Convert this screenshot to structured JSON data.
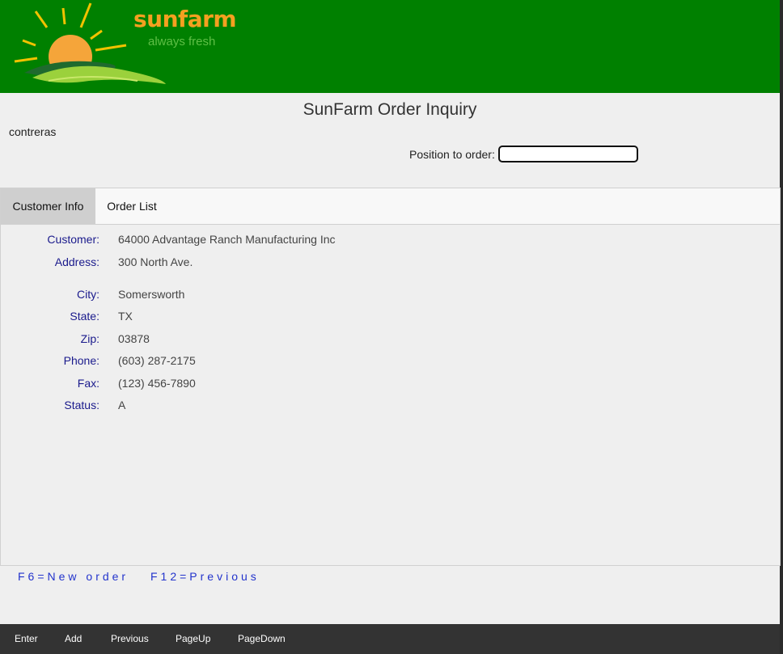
{
  "header": {
    "brand": "sunfarm",
    "tagline": "always fresh",
    "colors": {
      "background": "#008000",
      "brand": "#f5a020",
      "tagline": "#5fbf46"
    }
  },
  "page": {
    "title": "SunFarm Order Inquiry",
    "user": "contreras",
    "position_label": "Position to order:",
    "position_value": ""
  },
  "tabs": [
    {
      "label": "Customer Info",
      "active": true
    },
    {
      "label": "Order List",
      "active": false
    }
  ],
  "customer": {
    "customer_label": "Customer:",
    "customer_value": "64000 Advantage Ranch Manufacturing Inc",
    "address_label": "Address:",
    "address_value": "300 North Ave.",
    "city_label": "City:",
    "city_value": "Somersworth",
    "state_label": "State:",
    "state_value": "TX",
    "zip_label": "Zip:",
    "zip_value": "03878",
    "phone_label": "Phone:",
    "phone_value": "(603) 287-2175",
    "fax_label": "Fax:",
    "fax_value": "(123) 456-7890",
    "status_label": "Status:",
    "status_value": "A"
  },
  "function_keys": {
    "f6": "F6=New order",
    "f12": "F12=Previous"
  },
  "bottom_buttons": [
    "Enter",
    "Add",
    "Previous",
    "PageUp",
    "PageDown"
  ]
}
